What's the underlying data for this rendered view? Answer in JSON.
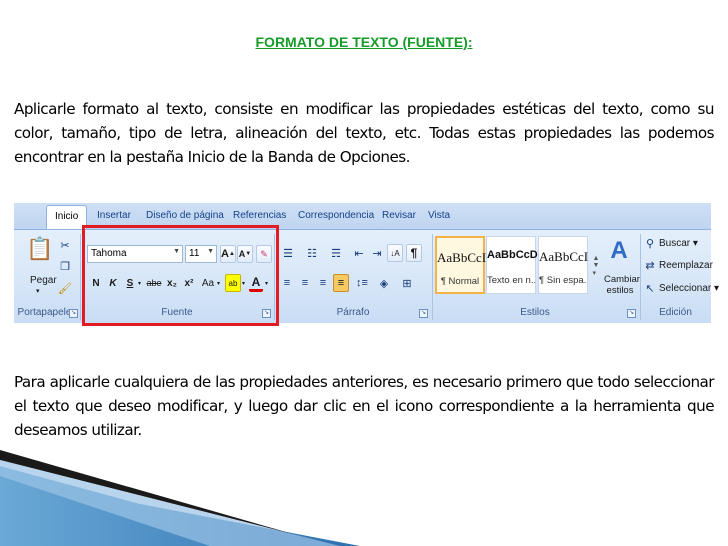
{
  "title": "FORMATO DE TEXTO (FUENTE):",
  "paragraph1": "Aplicarle formato al texto, consiste en modificar las propiedades estéticas del texto, como su color, tamaño, tipo de letra, alineación del texto, etc.  Todas estas propiedades las podemos encontrar en la pestaña Inicio de la Banda de Opciones.",
  "paragraph2": "Para aplicarle cualquiera de las propiedades anteriores, es necesario primero que todo seleccionar el texto que deseo modificar, y luego dar clic en el icono correspondiente a la herramienta que deseamos utilizar.",
  "ribbon": {
    "tabs": [
      "Inicio",
      "Insertar",
      "Diseño de página",
      "Referencias",
      "Correspondencia",
      "Revisar",
      "Vista"
    ],
    "groups": {
      "clipboard": "Portapapeles",
      "font": "Fuente",
      "paragraph": "Párrafo",
      "styles": "Estilos",
      "editing": "Edición"
    },
    "paste_label": "Pegar",
    "font_name": "Tahoma",
    "font_size": "11",
    "format_buttons": {
      "bold": "N",
      "italic": "K",
      "underline": "S",
      "strike": "abe",
      "subscript": "x₂",
      "superscript": "x²",
      "change_case": "Aa",
      "grow": "A",
      "shrink": "A"
    },
    "styles": [
      {
        "sample": "AaBbCcI",
        "name": "¶ Normal"
      },
      {
        "sample": "AaBbCcD",
        "name": "Texto en n..."
      },
      {
        "sample": "AaBbCcI",
        "name": "¶ Sin espa..."
      }
    ],
    "change_styles": "Cambiar estilos",
    "editing": {
      "find": "Buscar",
      "replace": "Reemplazar",
      "select": "Seleccionar"
    },
    "colors": {
      "accent_border": "#e31c24",
      "tab_text": "#15428b",
      "title_green": "#159b27"
    }
  }
}
